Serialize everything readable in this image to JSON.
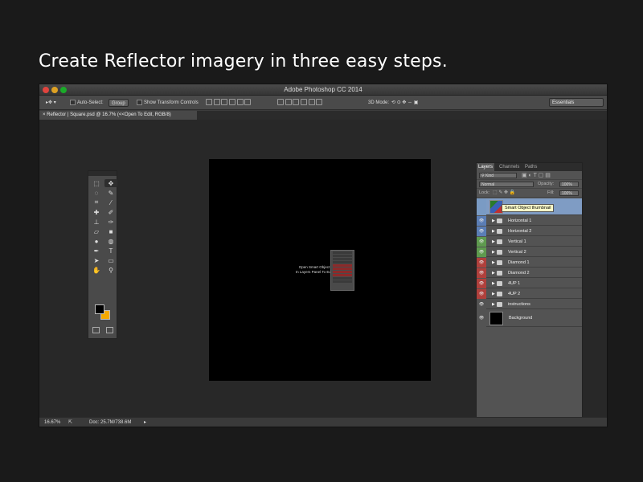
{
  "headline": "Create Reflector imagery in three easy steps.",
  "window": {
    "title": "Adobe Photoshop CC 2014"
  },
  "options_bar": {
    "auto_select_label": "Auto-Select:",
    "auto_select_value": "Group",
    "show_transform_label": "Show Transform Controls",
    "mode_3d_label": "3D Mode:",
    "workspace": "Essentials"
  },
  "document_tab": {
    "label": "Reflector | Square.psd @ 16.7% (<<Open To Edit, RGB/8)"
  },
  "canvas": {
    "instruction_line1": "Open Smart Object",
    "instruction_line2": "In Layers Panel To Edit"
  },
  "tools": {
    "foreground_color": "#000000",
    "background_color": "#f5a900"
  },
  "layers_panel": {
    "tabs": [
      "Layers",
      "Channels",
      "Paths"
    ],
    "filter_kind": "Kind",
    "blend_mode": "Normal",
    "opacity_label": "Opacity:",
    "opacity_value": "100%",
    "lock_label": "Lock:",
    "fill_label": "Fill:",
    "fill_value": "100%",
    "tooltip": "Smart Object thumbnail",
    "layers": [
      {
        "name": "<<Open To Edit",
        "tag_color": "#7a9bc4"
      },
      {
        "name": "Horizontal 1",
        "tag_color": "#5a7db5"
      },
      {
        "name": "Horizontal 2",
        "tag_color": "#5a7db5"
      },
      {
        "name": "Vertical 1",
        "tag_color": "#5e9a4e"
      },
      {
        "name": "Vertical 2",
        "tag_color": "#5e9a4e"
      },
      {
        "name": "Diamond 1",
        "tag_color": "#b0403c"
      },
      {
        "name": "Diamond 2",
        "tag_color": "#b0403c"
      },
      {
        "name": "4UP 1",
        "tag_color": "#b0403c"
      },
      {
        "name": "4UP 2",
        "tag_color": "#b0403c"
      },
      {
        "name": "instructions",
        "tag_color": "#535353"
      },
      {
        "name": "Background",
        "tag_color": "#535353"
      }
    ],
    "footer_icons": [
      "link-icon",
      "fx-icon",
      "mask-icon",
      "adjustment-icon",
      "group-icon",
      "new-layer-icon",
      "trash-icon"
    ]
  },
  "status_bar": {
    "zoom": "16.67%",
    "doc_info": "Doc: 25.7M/738.6M"
  }
}
